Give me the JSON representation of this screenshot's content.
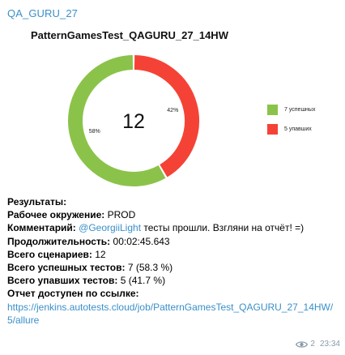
{
  "channel": {
    "sender_name": "QA_GURU_27"
  },
  "chart_data": {
    "type": "pie",
    "title": "PatternGamesTest_QAGURU_27_14HW",
    "center_text": "12",
    "slices": [
      {
        "name": "7 успешных",
        "value": 7,
        "percent_label": "58%",
        "color": "#8bc34a"
      },
      {
        "name": "5 упавших",
        "value": 5,
        "percent_label": "42%",
        "color": "#f44336"
      }
    ],
    "legend_position": "right"
  },
  "message": {
    "results_label": "Результаты:",
    "env_label": "Рабочее окружение:",
    "env_value": " PROD",
    "comment_label": "Комментарий:",
    "comment_mention": " @GeorgiiLight",
    "comment_text": " тесты прошли. Взгляни на отчёт! =)",
    "duration_label": "Продолжительность:",
    "duration_value": " 00:02:45.643",
    "total_label": "Всего сценариев:",
    "total_value": " 12",
    "passed_label": "Всего успешных тестов:",
    "passed_value": " 7 (58.3 %)",
    "failed_label": "Всего упавших тестов:",
    "failed_value": " 5 (41.7 %)",
    "report_label": "Отчет доступен по ссылке:",
    "report_url": "https://jenkins.autotests.cloud/job/PatternGamesTest_QAGURU_27_14HW/5/allure"
  },
  "footer": {
    "views": "2",
    "time": "23:34"
  }
}
